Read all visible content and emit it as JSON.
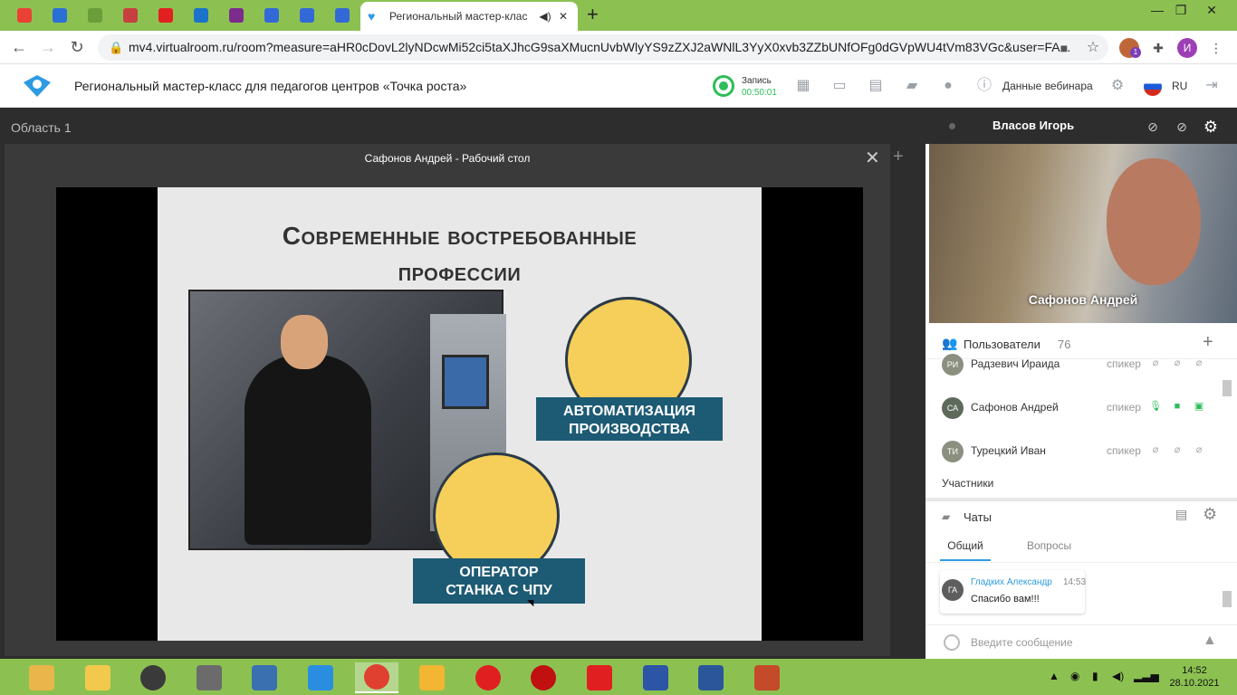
{
  "browser": {
    "pinned_tabs": [
      {
        "icon": "gmail-icon",
        "color": "#e94235"
      },
      {
        "icon": "app-grid-icon",
        "color": "#2a6fd6"
      },
      {
        "icon": "mail-icon",
        "color": "#6a9e3a"
      },
      {
        "icon": "app-icon",
        "color": "#c83f3f"
      },
      {
        "icon": "star-icon",
        "color": "#e32020"
      },
      {
        "icon": "outlook-icon",
        "color": "#1a73c8"
      },
      {
        "icon": "app-icon",
        "color": "#7b2c8c"
      },
      {
        "icon": "id-icon",
        "color": "#3369d6"
      },
      {
        "icon": "app-icon",
        "color": "#3369d6"
      },
      {
        "icon": "app-icon",
        "color": "#3369d6"
      }
    ],
    "active_tab": {
      "title": "Региональный мастер-клас",
      "icon": "virtualroom-icon"
    },
    "url": "mv4.virtualroom.ru/room?measure=aHR0cDovL2lyNDcwMi52ci5taXJhcG9saXMucnUvbWlyYS9zZXJ2aWNlL3YyX0xvb3ZZbUNfOFg0dGVpWU4tVm83VGc&user=FA...",
    "profile_initial": "И",
    "extension_badge": "1"
  },
  "app": {
    "title": "Региональный мастер-класс для педагогов центров «Точка роста»",
    "record_label": "Запись",
    "record_time": "00:50:01",
    "webinar_data": "Данные вебинара",
    "lang": "RU",
    "accent": "#2ebd59"
  },
  "main": {
    "area_label": "Область 1",
    "panel_title": "Сафонов Андрей - Рабочий стол",
    "slide": {
      "title_line1": "Современные востребованные",
      "title_line2": "профессии",
      "ribbon1_line1": "АВТОМАТИЗАЦИЯ",
      "ribbon1_line2": "ПРОИЗВОДСТВА",
      "ribbon2_line1": "ОПЕРАТОР",
      "ribbon2_line2": "СТАНКА С ЧПУ"
    }
  },
  "sidebar": {
    "video_header_name": "Власов Игорь",
    "video_label": "Сафонов Андрей",
    "users_title": "Пользователи",
    "users_count": "76",
    "users": [
      {
        "initials": "РИ",
        "name": "Радзевич Ираида",
        "role": "спикер",
        "active": false
      },
      {
        "initials": "СА",
        "name": "Сафонов Андрей",
        "role": "спикер",
        "active": true
      },
      {
        "initials": "ТИ",
        "name": "Турецкий Иван",
        "role": "спикер",
        "active": false
      }
    ],
    "participants_label": "Участники",
    "chat_title": "Чаты",
    "chat_tabs": [
      "Общий",
      "Вопросы"
    ],
    "message": {
      "initials": "ГА",
      "author": "Гладких Александр",
      "time": "14:53",
      "text": "Спасибо вам!!!"
    },
    "chat_placeholder": "Введите сообщение"
  },
  "taskbar": {
    "time": "14:52",
    "date": "28.10.2021",
    "apps": [
      {
        "icon": "system-icon",
        "color": "#e8b64a"
      },
      {
        "icon": "folder-icon",
        "color": "#f2c94c"
      },
      {
        "icon": "speaker-icon",
        "color": "#3a3a3a"
      },
      {
        "icon": "doc-icon",
        "color": "#6b6b6b"
      },
      {
        "icon": "settings-icon",
        "color": "#3a6fb0"
      },
      {
        "icon": "ie-icon",
        "color": "#2a8ee0"
      },
      {
        "icon": "chrome-icon",
        "color": "#e04030"
      },
      {
        "icon": "browser-icon",
        "color": "#f2b632"
      },
      {
        "icon": "yandex-icon",
        "color": "#e02020"
      },
      {
        "icon": "power-icon",
        "color": "#c01010"
      },
      {
        "icon": "yandex-browser-icon",
        "color": "#e02020"
      },
      {
        "icon": "save-icon",
        "color": "#2c55a6"
      },
      {
        "icon": "word-icon",
        "color": "#2b579a"
      },
      {
        "icon": "presentation-icon",
        "color": "#c44a2a"
      }
    ]
  }
}
